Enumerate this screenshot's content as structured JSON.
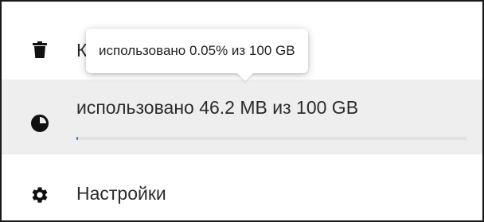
{
  "menu": {
    "trash": {
      "icon": "trash-icon",
      "label": "К"
    },
    "storage": {
      "icon": "pie-chart-icon",
      "label": "использовано 46.2 MB из 100 GB",
      "progress_percent": 0.05
    },
    "settings": {
      "icon": "gear-icon",
      "label": "Настройки"
    }
  },
  "tooltip": {
    "text": "использовано 0.05% из 100 GB"
  },
  "colors": {
    "selected_row_background": "#eeeeee",
    "progress_fill": "#1a73e8",
    "progress_track": "#e2e2e2",
    "icon": "#111111"
  }
}
